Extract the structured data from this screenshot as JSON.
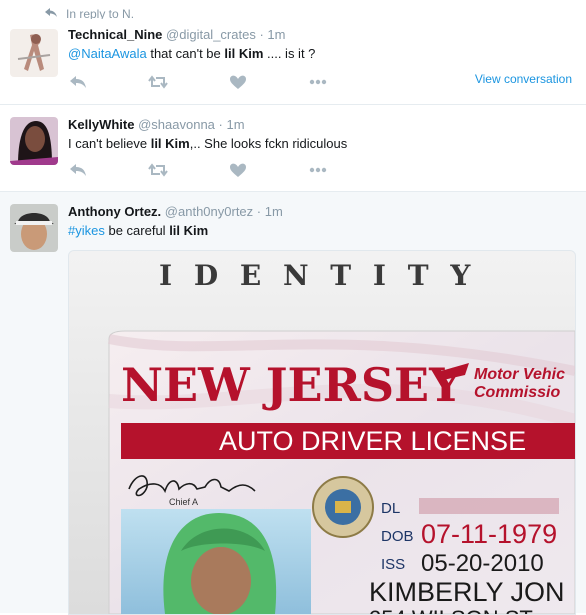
{
  "reply_context": {
    "label": "In reply to N."
  },
  "tweets": [
    {
      "display_name": "Technical_Nine",
      "handle": "@digital_crates",
      "separator": "·",
      "time": "1m",
      "mention": "@NaitaAwala",
      "text_pre": " that can't be ",
      "text_bold": "lil Kim",
      "text_post": " .... is it ?",
      "view_conversation": "View conversation"
    },
    {
      "display_name": "KellyWhite",
      "handle": "@shaavonna",
      "separator": "·",
      "time": "1m",
      "text_pre": "I can't believe ",
      "text_bold": "lil Kim",
      "text_post": ",.. She looks fckn ridiculous"
    },
    {
      "display_name": "Anthony Ortez.",
      "handle": "@anth0ny0rtez",
      "separator": "·",
      "time": "1m",
      "hashtag": "#yikes",
      "text_pre": " be careful ",
      "text_bold": "lil Kim"
    }
  ],
  "license_image": {
    "banner": "I D E N T I T Y",
    "state": "NEW JERSEY",
    "agency_line1": "Motor Vehic",
    "agency_line2": "Commissio",
    "type": "AUTO DRIVER LICENSE",
    "chief_label": "Chief A",
    "dl_label": "DL",
    "dob_label": "DOB",
    "dob_value": "07-11-1979",
    "iss_label": "ISS",
    "iss_value": "05-20-2010",
    "name_value": "KIMBERLY JON",
    "address_value": "254 WILSON ST"
  },
  "colors": {
    "link": "#1b95e0",
    "muted": "#8899a6",
    "license_red": "#b5122c",
    "hair_green": "#53b96a"
  }
}
